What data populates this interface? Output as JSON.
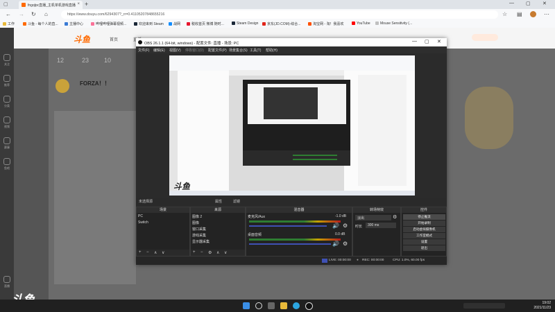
{
  "browser": {
    "tab_title": "fngqlpc直播_主机单机游戏直播",
    "address": "https://www.douyu.com/6294307?_rr=0.41105207848655216",
    "bookmarks": [
      "工作",
      "斗鱼 - 每个人的直...",
      "主播中心",
      "哔哩哔哩弹幕视频...",
      "欢迎来到 Steam",
      "战网",
      "税收首页 微博 随时...",
      "Steam Design",
      "京东(JD.COM)-综合...",
      "淘宝网 - 淘！我喜欢",
      "YouTube",
      "Mouse Sensitivity (..."
    ]
  },
  "site": {
    "logo": "斗鱼",
    "rail_items": [
      "关注",
      "推荐",
      "分类",
      "视频",
      "赛事",
      "鱼吧",
      "直播"
    ],
    "top_nums": [
      "12",
      "23",
      "10"
    ],
    "room_title": "FORZA！！",
    "nav": [
      "首页",
      "直播"
    ]
  },
  "obs": {
    "title": "OBS 26.1.1 (64-bit, windows) - 配置文件: 直播 - 场景: PC",
    "menu": [
      "文件(F)",
      "编辑(E)",
      "视图(V)",
      "停靠窗口(D)",
      "配置文件(P)",
      "场景集合(S)",
      "工具(T)",
      "帮助(H)"
    ],
    "watermark": "斗鱼",
    "selected_source": "未选择源",
    "props_label": "属性",
    "filters_label": "滤镜",
    "panels": {
      "scenes": {
        "header": "场景",
        "items": [
          "PC",
          "Switch"
        ]
      },
      "sources": {
        "header": "来源",
        "items": [
          "图像 2",
          "图像",
          "窗口采集",
          "游戏采集",
          "显示器采集"
        ]
      },
      "mixer": {
        "header": "混音器",
        "tracks": [
          {
            "name": "麦克风/Aux",
            "db": "-1.0 dB"
          },
          {
            "name": "桌面音频",
            "db": "0.0 dB"
          }
        ]
      },
      "transitions": {
        "header": "转场特效",
        "type": "淡出",
        "duration_label": "时长",
        "duration": "300 ms"
      },
      "controls": {
        "header": "控件",
        "buttons": [
          "停止推流",
          "开始录制",
          "启动虚拟摄像机",
          "工作室模式",
          "设置",
          "退出"
        ]
      }
    },
    "status": {
      "live": "LIVE: 00:00:00",
      "rec": "REC: 00:00:00",
      "cpu": "CPU: 1.0%, 60.00 fps"
    }
  },
  "taskbar": {
    "time": "19:02",
    "date": "2021/11/23"
  }
}
